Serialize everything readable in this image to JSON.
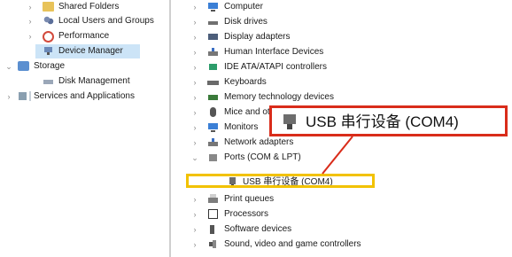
{
  "left_tree": [
    {
      "label": "Shared Folders",
      "expander": "›",
      "icon": "shared-folders-icon"
    },
    {
      "label": "Local Users and Groups",
      "expander": "›",
      "icon": "users-icon"
    },
    {
      "label": "Performance",
      "expander": "›",
      "icon": "performance-icon"
    },
    {
      "label": "Device Manager",
      "expander": "",
      "icon": "device-manager-icon"
    },
    {
      "label": "Storage",
      "expander": "⌄",
      "icon": "storage-icon"
    },
    {
      "label": "Disk Management",
      "expander": "",
      "icon": "disk-management-icon"
    },
    {
      "label": "Services and Applications",
      "expander": "›",
      "icon": "services-icon"
    }
  ],
  "device_tree": [
    {
      "label": "Computer",
      "expander": "›",
      "icon": "computer-icon"
    },
    {
      "label": "Disk drives",
      "expander": "›",
      "icon": "disk-drive-icon"
    },
    {
      "label": "Display adapters",
      "expander": "›",
      "icon": "display-adapter-icon"
    },
    {
      "label": "Human Interface Devices",
      "expander": "›",
      "icon": "hid-icon"
    },
    {
      "label": "IDE ATA/ATAPI controllers",
      "expander": "›",
      "icon": "ide-controller-icon"
    },
    {
      "label": "Keyboards",
      "expander": "›",
      "icon": "keyboard-icon"
    },
    {
      "label": "Memory technology devices",
      "expander": "›",
      "icon": "memory-icon"
    },
    {
      "label": "Mice and other pointing devices",
      "expander": "›",
      "icon": "mouse-icon"
    },
    {
      "label": "Monitors",
      "expander": "›",
      "icon": "monitor-icon"
    },
    {
      "label": "Network adapters",
      "expander": "›",
      "icon": "network-adapter-icon"
    },
    {
      "label": "Ports (COM & LPT)",
      "expander": "⌄",
      "icon": "ports-icon"
    },
    {
      "label": "USB 串行设备 (COM4)",
      "expander": "",
      "icon": "usb-serial-icon"
    },
    {
      "label": "Print queues",
      "expander": "›",
      "icon": "print-queue-icon"
    },
    {
      "label": "Processors",
      "expander": "›",
      "icon": "processor-icon"
    },
    {
      "label": "Software devices",
      "expander": "›",
      "icon": "software-device-icon"
    },
    {
      "label": "Sound, video and game controllers",
      "expander": "›",
      "icon": "sound-icon"
    }
  ],
  "callout": {
    "label": "USB 串行设备 (COM4)",
    "icon": "usb-serial-icon"
  },
  "colors": {
    "highlight_box": "#f2c200",
    "callout_border": "#d92c1a",
    "selected_row": "#cce4f7"
  }
}
